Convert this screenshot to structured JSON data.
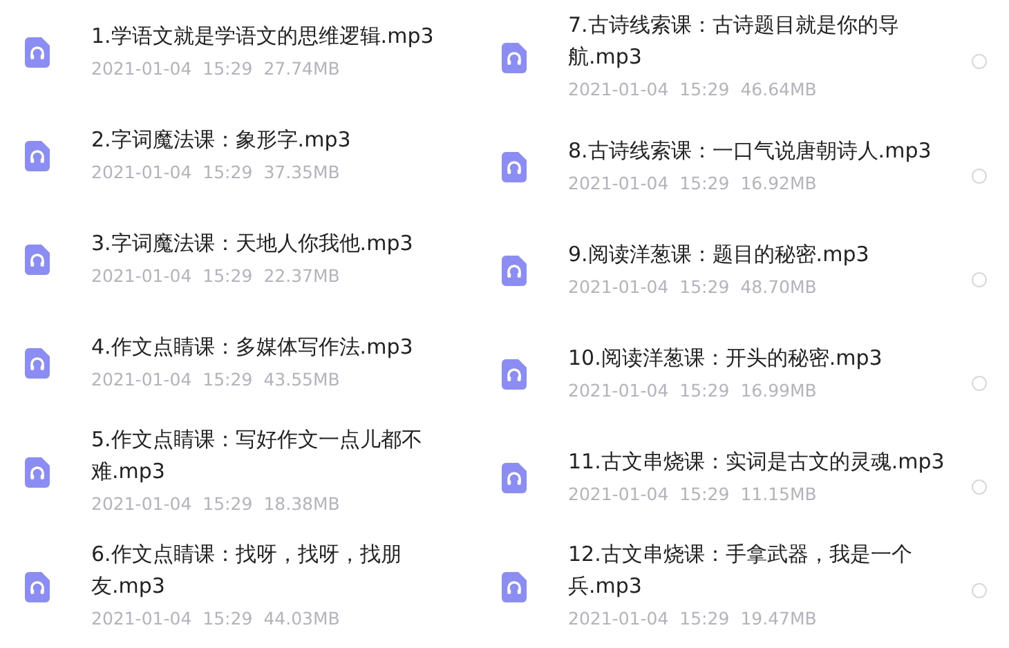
{
  "columns": [
    {
      "items": [
        {
          "title": "1.学语文就是学语文的思维逻辑.mp3",
          "date": "2021-01-04",
          "time": "15:29",
          "size": "27.74MB"
        },
        {
          "title": "2.字词魔法课：象形字.mp3",
          "date": "2021-01-04",
          "time": "15:29",
          "size": "37.35MB"
        },
        {
          "title": "3.字词魔法课：天地人你我他.mp3",
          "date": "2021-01-04",
          "time": "15:29",
          "size": "22.37MB"
        },
        {
          "title": "4.作文点睛课：多媒体写作法.mp3",
          "date": "2021-01-04",
          "time": "15:29",
          "size": "43.55MB"
        },
        {
          "title": "5.作文点睛课：写好作文一点儿都不难.mp3",
          "date": "2021-01-04",
          "time": "15:29",
          "size": "18.38MB"
        },
        {
          "title": "6.作文点睛课：找呀，找呀，找朋友.mp3",
          "date": "2021-01-04",
          "time": "15:29",
          "size": "44.03MB"
        }
      ]
    },
    {
      "items": [
        {
          "title": "7.古诗线索课：古诗题目就是你的导航.mp3",
          "date": "2021-01-04",
          "time": "15:29",
          "size": "46.64MB",
          "selected": false
        },
        {
          "title": "8.古诗线索课：一口气说唐朝诗人.mp3",
          "date": "2021-01-04",
          "time": "15:29",
          "size": "16.92MB",
          "selected": false
        },
        {
          "title": "9.阅读洋葱课：题目的秘密.mp3",
          "date": "2021-01-04",
          "time": "15:29",
          "size": "48.70MB",
          "selected": false
        },
        {
          "title": "10.阅读洋葱课：开头的秘密.mp3",
          "date": "2021-01-04",
          "time": "15:29",
          "size": "16.99MB",
          "selected": false
        },
        {
          "title": "11.古文串烧课：实词是古文的灵魂.mp3",
          "date": "2021-01-04",
          "time": "15:29",
          "size": "11.15MB",
          "selected": false
        },
        {
          "title": "12.古文串烧课：手拿武器，我是一个兵.mp3",
          "date": "2021-01-04",
          "time": "15:29",
          "size": "19.47MB",
          "selected": false
        }
      ]
    }
  ]
}
